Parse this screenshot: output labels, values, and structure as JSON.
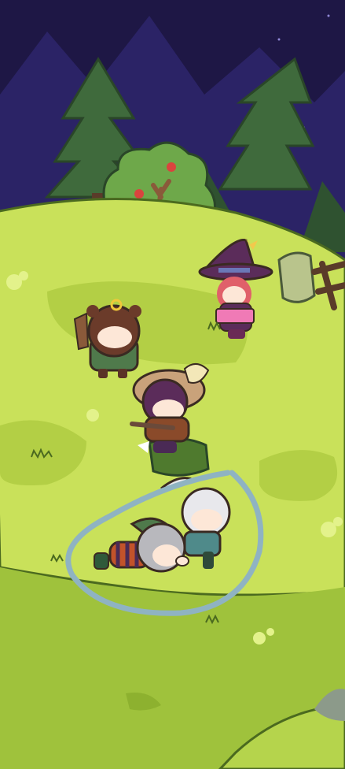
{
  "scene": {
    "name": "forest-hill-camp",
    "colors": {
      "sky": "#1e1745",
      "sky_mountain": "#2b2366",
      "pine": "#3f6a3c",
      "pine_dark": "#2f5230",
      "hill": "#c9e15a",
      "hill_shade": "#b3cf45",
      "ground_lower": "#9fc23c",
      "highlight_ring": "#8fb3c2",
      "outline": "#3a2a22"
    },
    "characters": [
      {
        "id": "bear-hood-kid",
        "role": "holding wooden sword"
      },
      {
        "id": "witch",
        "role": "reading pink book"
      },
      {
        "id": "hat-rider",
        "role": "sitting on tree stump with crossbow"
      },
      {
        "id": "white-haired-elf",
        "role": "leaning over"
      },
      {
        "id": "grey-haired-kid",
        "role": "lying on the ground"
      }
    ],
    "props": [
      "pine-tree",
      "apple-tree",
      "tree-stump",
      "rock",
      "wooden-fence",
      "sparkles"
    ]
  }
}
